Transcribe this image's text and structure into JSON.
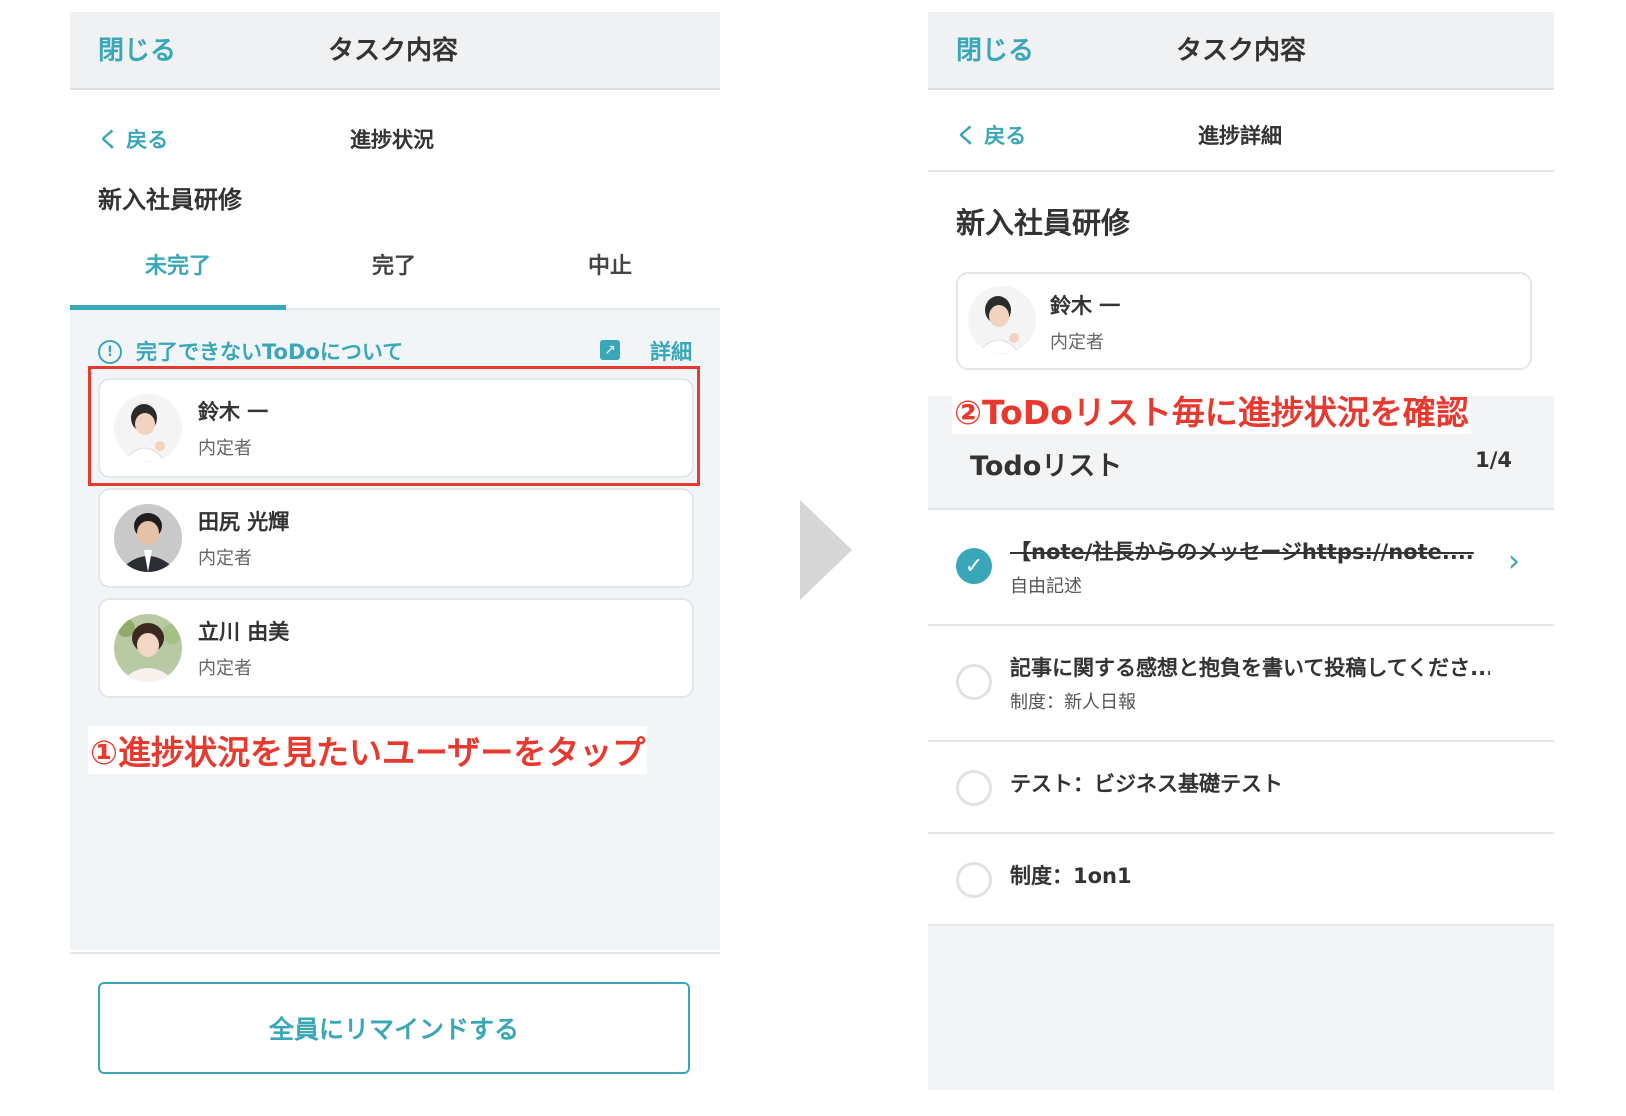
{
  "left": {
    "header": {
      "close": "閉じる",
      "title": "タスク内容"
    },
    "subheader": {
      "back": "く 戻る",
      "title": "進捗状況"
    },
    "course_title": "新入社員研修",
    "tabs": [
      {
        "label": "未完了",
        "active": true
      },
      {
        "label": "完了",
        "active": false
      },
      {
        "label": "中止",
        "active": false
      }
    ],
    "info": {
      "icon": "!",
      "text": "完了できないToDoについて",
      "detail_icon": "↗",
      "detail": "詳細"
    },
    "users": [
      {
        "name": "鈴木 一",
        "role": "内定者"
      },
      {
        "name": "田尻 光輝",
        "role": "内定者"
      },
      {
        "name": "立川 由美",
        "role": "内定者"
      }
    ],
    "annotation": "①進捗状況を見たいユーザーをタップ",
    "remind_button": "全員にリマインドする"
  },
  "right": {
    "header": {
      "close": "閉じる",
      "title": "タスク内容"
    },
    "subheader": {
      "back": "く 戻る",
      "title": "進捗詳細"
    },
    "course_title": "新入社員研修",
    "profile": {
      "name": "鈴木 一",
      "role": "内定者"
    },
    "annotation": "②ToDoリスト毎に進捗状況を確認",
    "list_title": "Todoリスト",
    "list_count": "1/4",
    "todos": [
      {
        "title": "【note/社長からのメッセージhttps://note....",
        "sub": "自由記述",
        "done": true,
        "check": "✓",
        "chevron": "›"
      },
      {
        "title": "記事に関する感想と抱負を書いて投稿してくださ...",
        "sub": "制度：新人日報",
        "done": false
      },
      {
        "title": "テスト：ビジネス基礎テスト",
        "sub": "",
        "done": false
      },
      {
        "title": "制度：1on1",
        "sub": "",
        "done": false
      }
    ]
  },
  "colors": {
    "accent": "#3aa7b8",
    "annotation": "#e8392f",
    "arrow": "#d6d6d6"
  }
}
